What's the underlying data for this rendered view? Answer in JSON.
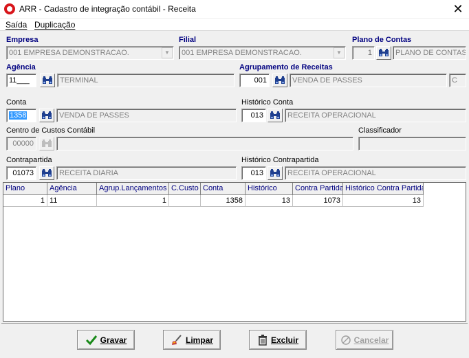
{
  "window": {
    "title": "ARR - Cadastro de integração contábil - Receita",
    "close_glyph": "✕"
  },
  "menu": {
    "items": [
      "Saída",
      "Duplicação"
    ]
  },
  "form": {
    "empresa": {
      "label": "Empresa",
      "value": "001 EMPRESA DEMONSTRACAO."
    },
    "filial": {
      "label": "Filial",
      "value": "001 EMPRESA DEMONSTRACAO."
    },
    "plano": {
      "label": "Plano de Contas",
      "code": "1",
      "description": "PLANO DE CONTAS"
    },
    "agencia": {
      "label": "Agência",
      "code": "11___",
      "description": "TERMINAL"
    },
    "agrupamento": {
      "label": "Agrupamento de Receitas",
      "code": "001",
      "description": "VENDA DE PASSES",
      "extra": "C"
    },
    "conta": {
      "label": "Conta",
      "code": "1358",
      "description": "VENDA DE PASSES"
    },
    "historico_conta": {
      "label": "Histórico Conta",
      "code": "013",
      "description": "RECEITA OPERACIONAL"
    },
    "centro_custos": {
      "label": "Centro de Custos Contábil",
      "code": "00000",
      "description": ""
    },
    "classificador": {
      "label": "Classificador",
      "value": ""
    },
    "contrapartida": {
      "label": "Contrapartida",
      "code": "01073",
      "description": "RECEITA DIARIA"
    },
    "historico_contrapartida": {
      "label": "Histórico Contrapartida",
      "code": "013",
      "description": "RECEITA OPERACIONAL"
    }
  },
  "grid": {
    "columns": [
      "Plano",
      "Agência",
      "Agrup.Lançamentos",
      "C.Custo",
      "Conta",
      "Histórico",
      "Contra Partida",
      "Histórico Contra Partida"
    ],
    "rows": [
      [
        "1",
        "11",
        "1",
        "",
        "1358",
        "13",
        "1073",
        "13"
      ]
    ]
  },
  "buttons": {
    "gravar": {
      "label": "Gravar",
      "icon": "check-icon"
    },
    "limpar": {
      "label": "Limpar",
      "icon": "brush-icon"
    },
    "excluir": {
      "label": "Excluir",
      "icon": "trash-icon"
    },
    "cancelar": {
      "label": "Cancelar",
      "icon": "cancel-icon"
    }
  },
  "colors": {
    "label_accent": "#000080",
    "selection": "#3399ff",
    "check_green": "#1a8a1a"
  }
}
